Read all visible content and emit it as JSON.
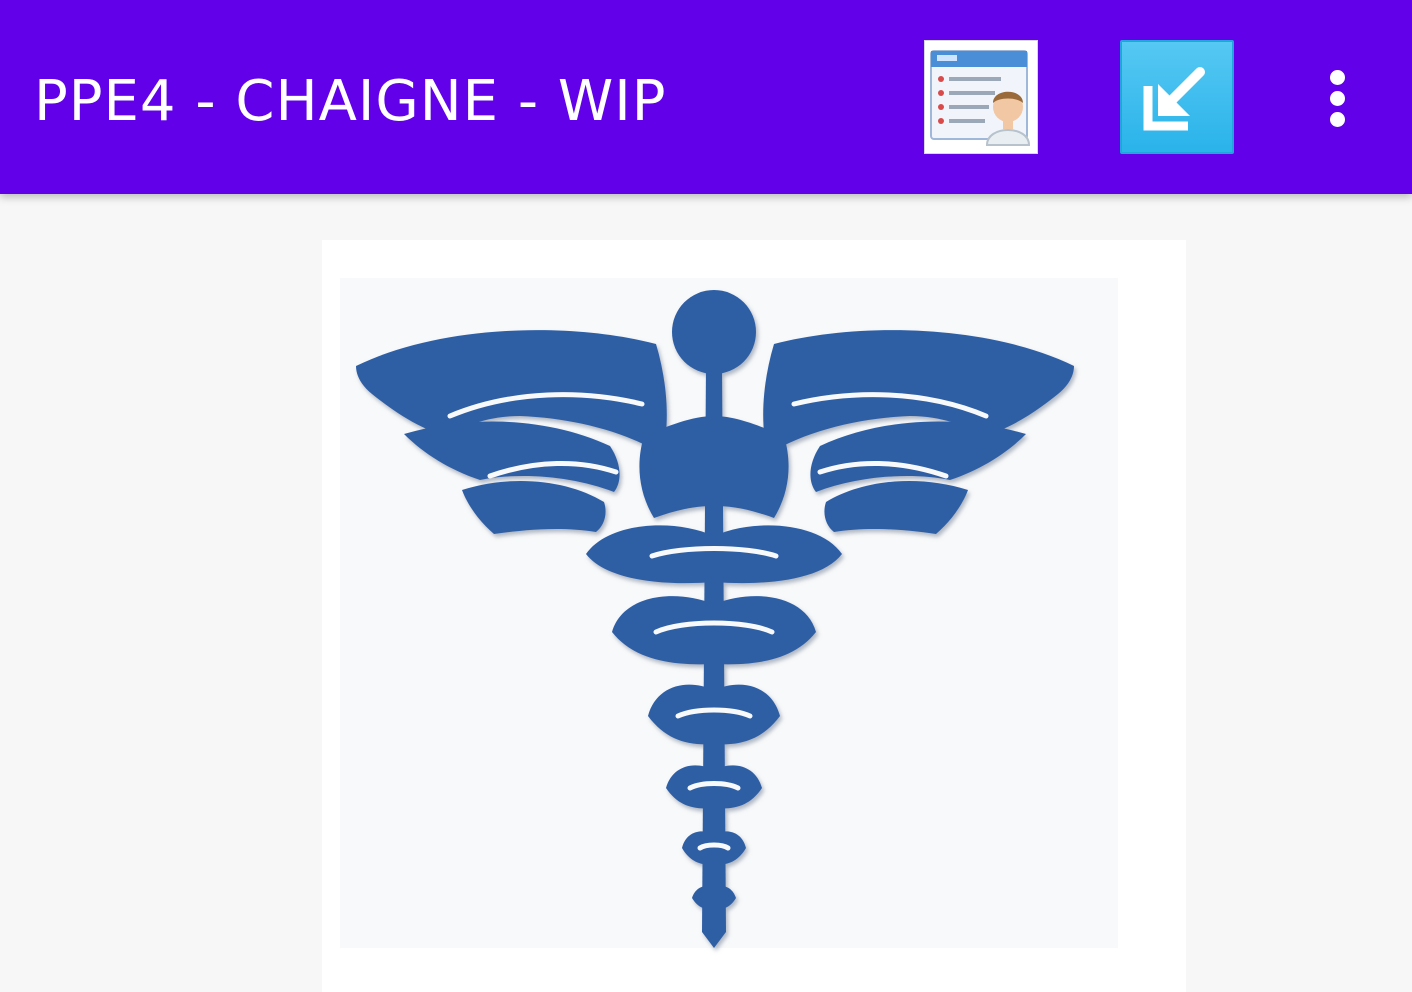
{
  "app_bar": {
    "title": "PPE4 - CHAIGNE - WIP",
    "background_color": "#6200ea",
    "actions": [
      {
        "icon": "contact-list-icon"
      },
      {
        "icon": "import-icon"
      },
      {
        "icon": "more-vert-icon"
      }
    ]
  },
  "content": {
    "logo": {
      "icon": "caduceus-icon",
      "color": "#2f5fa5"
    }
  }
}
